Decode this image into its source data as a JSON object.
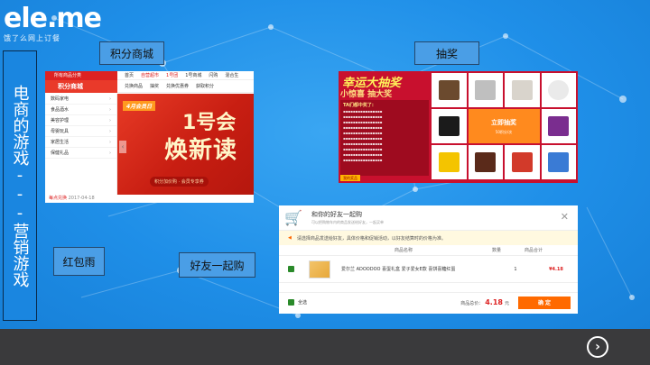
{
  "brand": {
    "logo_text": "ele.me",
    "slogan": "饿了么网上订餐"
  },
  "slide": {
    "vertical_title": "电商的游戏---营销游戏"
  },
  "labels": {
    "points_mall": "积分商城",
    "lottery": "抽奖",
    "red_packet_rain": "红包雨",
    "buy_with_friends": "好友一起购"
  },
  "shop": {
    "all_categories": "所有商品分类",
    "nav": [
      "首页",
      "自营超市",
      "1号团",
      "1号商城",
      "闪购",
      "混合生"
    ],
    "section_title": "积分商城",
    "section_links": [
      "兑换商品",
      "抽奖",
      "兑换优惠券",
      "获取积分"
    ],
    "side_items": [
      "数码家电",
      "食品酒水",
      "美容护理",
      "母婴玩具",
      "家居生活",
      "保健礼品"
    ],
    "banner_ribbon": "4月会员日",
    "banner_line1": "1号会",
    "banner_line2": "焕新读",
    "banner_tag": "积分加价购 · 会员专享券",
    "footer_label": "每点兑换",
    "footer_date": "2017-04-18"
  },
  "lottery": {
    "title": "幸运大抽奖",
    "subtitle": "小惊喜 抽大奖",
    "list_header": "TA们都中奖了:",
    "draw_button": "立即抽奖",
    "draw_sub": "50积分/次",
    "mini_button": "我的奖品"
  },
  "buy": {
    "title": "和你的好友一起购",
    "subtitle": "可以把购物车内的商品发送给好友，一起买单",
    "notice": "请选择商品发送给好友，具体价格和促销活动，以好友结算时的价格为准。",
    "col_name": "商品名称",
    "col_qty": "数量",
    "col_total": "商品合计",
    "item_name": "爱尔兰 ADOODOO 喜蛋礼盒 爱子爱女E款 喜饼喜糖红蛋",
    "item_qty": "1",
    "item_price": "¥4.18",
    "select_all": "全选",
    "total_label": "商品总价：",
    "total_value": "4.18",
    "total_unit": "元",
    "confirm": "确 定"
  },
  "icons": {
    "next": "chevron-right-circle-icon",
    "close": "close-icon",
    "cart": "cart-icon"
  },
  "colors": {
    "background": "#1f8fe8",
    "footer": "#3a3a3c",
    "accent_red": "#c8102e",
    "accent_orange": "#ff6a00"
  }
}
